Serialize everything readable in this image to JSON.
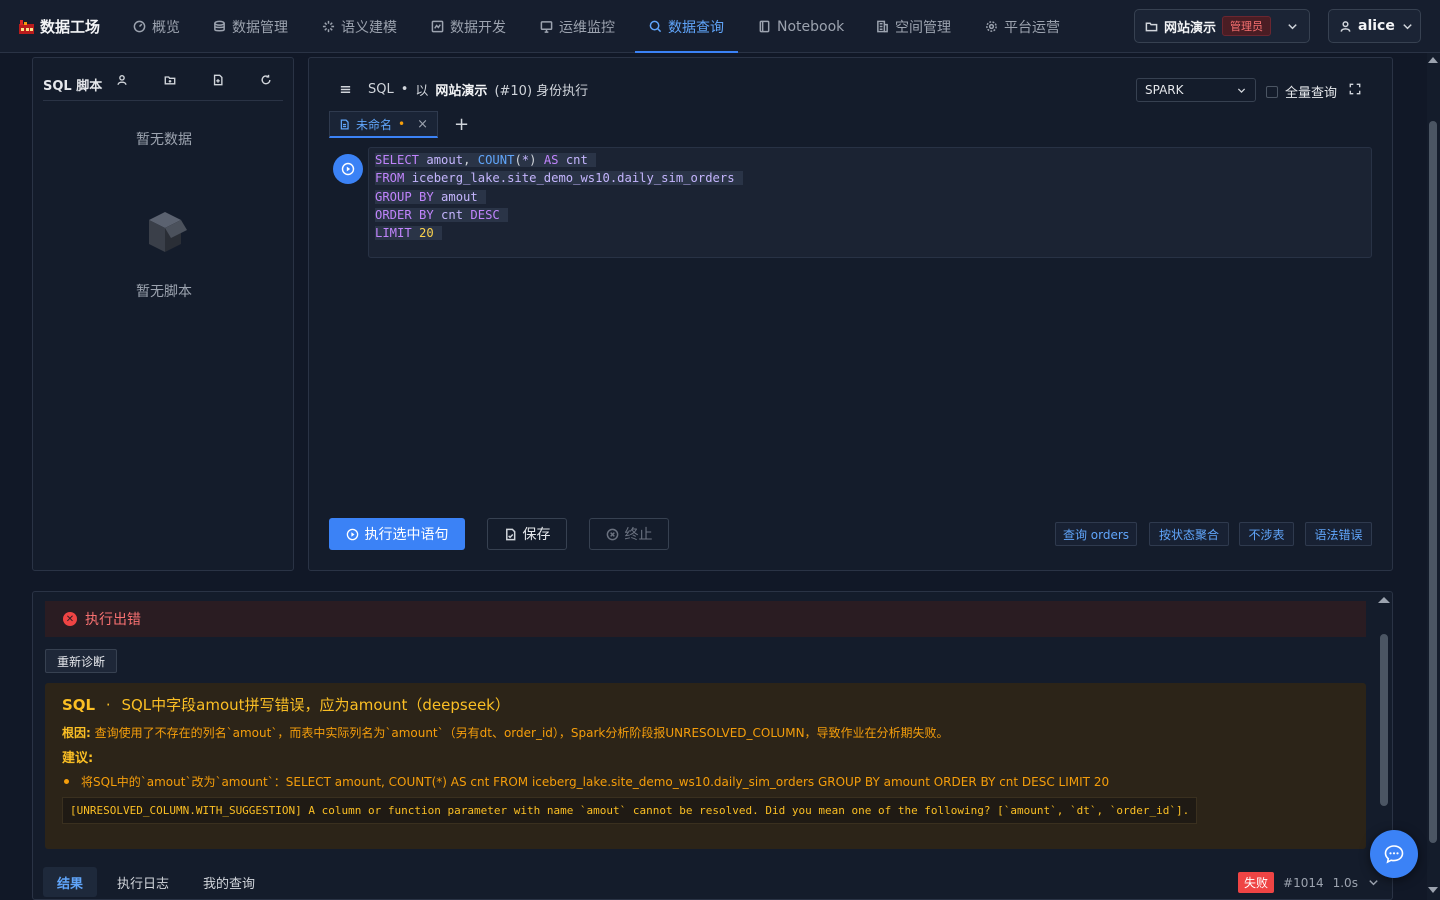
{
  "app": {
    "logo_text": "数据工场"
  },
  "nav": [
    {
      "label": "概览",
      "icon": "dashboard-icon"
    },
    {
      "label": "数据管理",
      "icon": "database-icon"
    },
    {
      "label": "语义建模",
      "icon": "semantic-icon"
    },
    {
      "label": "数据开发",
      "icon": "dev-icon"
    },
    {
      "label": "运维监控",
      "icon": "monitor-icon"
    },
    {
      "label": "数据查询",
      "icon": "search-icon",
      "active": true
    },
    {
      "label": "Notebook",
      "icon": "notebook-icon"
    },
    {
      "label": "空间管理",
      "icon": "building-icon"
    },
    {
      "label": "平台运营",
      "icon": "gear-icon"
    }
  ],
  "workspace": {
    "name": "网站演示",
    "role_badge": "管理员"
  },
  "user": {
    "name": "alice"
  },
  "script_panel": {
    "title": "SQL 脚本",
    "empty_data": "暂无数据",
    "empty_scripts": "暂无脚本"
  },
  "editor": {
    "header_prefix": "SQL",
    "header_dot": "•",
    "header_as": "以",
    "workspace_name": "网站演示",
    "header_suffix": "(#10) 身份执行",
    "engine": "SPARK",
    "full_query_label": "全量查询",
    "tab_label": "未命名",
    "tab_dirty": "•",
    "add_tab": "+",
    "code_lines": [
      "SELECT amout, COUNT(*) AS cnt",
      "FROM iceberg_lake.site_demo_ws10.daily_sim_orders",
      "GROUP BY amout",
      "ORDER BY cnt DESC",
      "LIMIT 20"
    ],
    "run_label": "执行选中语句",
    "save_label": "保存",
    "stop_label": "终止",
    "quick_actions": [
      "查询 orders",
      "按状态聚合",
      "不涉表",
      "语法错误"
    ]
  },
  "result": {
    "error_banner": "执行出错",
    "rediagnose_label": "重新诊断",
    "diagnosis": {
      "title_prefix": "SQL",
      "title_dot": "·",
      "title_text": "SQL中字段amout拼写错误，应为amount（deepseek）",
      "root_label": "根因:",
      "root_text": "查询使用了不存在的列名`amout`，而表中实际列名为`amount`（另有dt、order_id），Spark分析阶段报UNRESOLVED_COLUMN，导致作业在分析期失败。",
      "suggest_label": "建议:",
      "suggestion": "将SQL中的`amout`改为`amount`：SELECT amount, COUNT(*) AS cnt FROM iceberg_lake.site_demo_ws10.daily_sim_orders GROUP BY amount ORDER BY cnt DESC LIMIT 20",
      "raw_error": "[UNRESOLVED_COLUMN.WITH_SUGGESTION] A column or function parameter with name `amout` cannot be resolved. Did you mean one of the following? [`amount`, `dt`, `order_id`]."
    },
    "tabs": [
      "结果",
      "执行日志",
      "我的查询"
    ],
    "status_badge": "失败",
    "job_id": "#1014",
    "duration": "1.0s"
  },
  "colors": {
    "accent": "#3b82f6",
    "error": "#ef4444",
    "warning": "#f59e0b",
    "background": "#111827"
  }
}
